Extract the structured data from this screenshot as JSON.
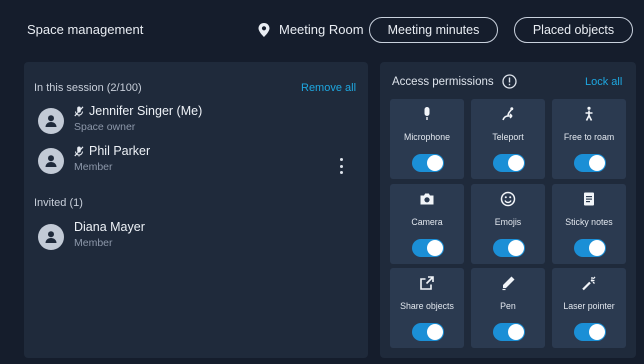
{
  "header": {
    "title": "Space management",
    "location": "Meeting Room",
    "minutes_button": "Meeting minutes",
    "objects_button": "Placed objects"
  },
  "session": {
    "label": "In this session (2/100)",
    "remove_all": "Remove all",
    "participants": [
      {
        "name": "Jennifer Singer (Me)",
        "role": "Space owner"
      },
      {
        "name": "Phil Parker",
        "role": "Member"
      }
    ]
  },
  "invited": {
    "label": "Invited (1)",
    "people": [
      {
        "name": "Diana Mayer",
        "role": "Member"
      }
    ]
  },
  "permissions": {
    "title": "Access permissions",
    "lock_all": "Lock all",
    "items": [
      {
        "label": "Microphone",
        "icon": "microphone-icon",
        "enabled": true
      },
      {
        "label": "Teleport",
        "icon": "teleport-icon",
        "enabled": true
      },
      {
        "label": "Free to roam",
        "icon": "walking-person-icon",
        "enabled": true
      },
      {
        "label": "Camera",
        "icon": "camera-icon",
        "enabled": true
      },
      {
        "label": "Emojis",
        "icon": "smiley-icon",
        "enabled": true
      },
      {
        "label": "Sticky notes",
        "icon": "note-icon",
        "enabled": true
      },
      {
        "label": "Share objects",
        "icon": "share-icon",
        "enabled": true
      },
      {
        "label": "Pen",
        "icon": "pen-icon",
        "enabled": true
      },
      {
        "label": "Laser pointer",
        "icon": "laser-pointer-icon",
        "enabled": true
      }
    ]
  },
  "colors": {
    "background": "#151d2c",
    "panel": "#1f2a3b",
    "tile": "#2b3a50",
    "accent": "#1ea7e0",
    "toggle_on": "#1b8fd6"
  }
}
